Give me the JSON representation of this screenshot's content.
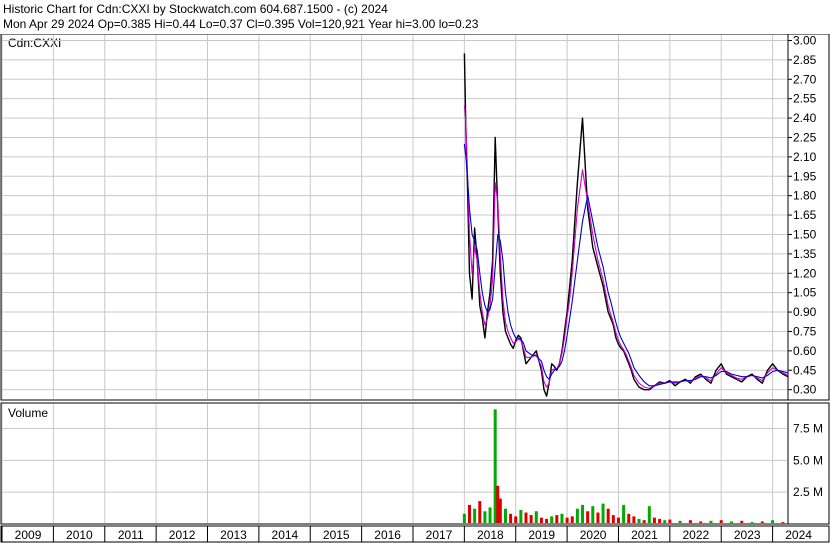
{
  "header": {
    "line1": "Historic Chart for Cdn:CXXI by Stockwatch.com 604.687.1500 - (c) 2024",
    "line2": "Mon Apr 29 2024   Op=0.385  Hi=0.44  Lo=0.37  Cl=0.395  Vol=120,921  Year hi=3.00  lo=0.23"
  },
  "chart_data": [
    {
      "type": "line",
      "panel_label": "Cdn:CXXI",
      "ylim": [
        0.22,
        3.05
      ],
      "y_ticks": [
        "3.00",
        "2.85",
        "2.70",
        "2.55",
        "2.40",
        "2.25",
        "2.10",
        "1.95",
        "1.80",
        "1.65",
        "1.50",
        "1.35",
        "1.20",
        "1.05",
        "0.90",
        "0.75",
        "0.60",
        "0.45",
        "0.30"
      ],
      "x_ticks": [
        "2009",
        "2010",
        "2011",
        "2012",
        "2013",
        "2014",
        "2015",
        "2016",
        "2017",
        "2018",
        "2019",
        "2020",
        "2021",
        "2022",
        "2023",
        "2024"
      ],
      "grid": true,
      "colors": {
        "price": "#000000",
        "ma_short": "#cc00cc",
        "ma_long": "#0000cc",
        "grid": "#c8c8c8"
      },
      "x": [
        2018.0,
        2018.03,
        2018.06,
        2018.1,
        2018.15,
        2018.2,
        2018.25,
        2018.3,
        2018.35,
        2018.4,
        2018.45,
        2018.5,
        2018.55,
        2018.6,
        2018.65,
        2018.7,
        2018.75,
        2018.8,
        2018.85,
        2018.9,
        2018.95,
        2019.0,
        2019.05,
        2019.1,
        2019.15,
        2019.2,
        2019.3,
        2019.4,
        2019.5,
        2019.55,
        2019.6,
        2019.65,
        2019.7,
        2019.75,
        2019.8,
        2019.85,
        2019.9,
        2019.95,
        2020.0,
        2020.05,
        2020.1,
        2020.2,
        2020.3,
        2020.4,
        2020.5,
        2020.6,
        2020.7,
        2020.75,
        2020.8,
        2020.85,
        2020.9,
        2020.95,
        2021.0,
        2021.05,
        2021.1,
        2021.15,
        2021.2,
        2021.25,
        2021.3,
        2021.4,
        2021.5,
        2021.6,
        2021.7,
        2021.8,
        2021.9,
        2022.0,
        2022.1,
        2022.2,
        2022.3,
        2022.4,
        2022.5,
        2022.6,
        2022.7,
        2022.8,
        2022.9,
        2023.0,
        2023.1,
        2023.2,
        2023.3,
        2023.4,
        2023.5,
        2023.6,
        2023.7,
        2023.8,
        2023.9,
        2024.0,
        2024.1,
        2024.2,
        2024.3
      ],
      "series": [
        {
          "key": "price",
          "values": [
            2.9,
            2.3,
            1.9,
            1.2,
            1.0,
            1.55,
            1.3,
            0.95,
            0.85,
            0.7,
            0.9,
            1.05,
            1.3,
            2.25,
            1.7,
            1.2,
            0.9,
            0.75,
            0.7,
            0.65,
            0.62,
            0.68,
            0.72,
            0.7,
            0.6,
            0.5,
            0.55,
            0.6,
            0.45,
            0.3,
            0.25,
            0.35,
            0.5,
            0.48,
            0.45,
            0.5,
            0.6,
            0.75,
            0.9,
            1.1,
            1.3,
            1.9,
            2.4,
            1.7,
            1.4,
            1.25,
            1.1,
            1.0,
            0.9,
            0.85,
            0.8,
            0.7,
            0.65,
            0.62,
            0.6,
            0.55,
            0.5,
            0.45,
            0.38,
            0.32,
            0.3,
            0.3,
            0.33,
            0.36,
            0.35,
            0.37,
            0.33,
            0.36,
            0.38,
            0.35,
            0.4,
            0.42,
            0.38,
            0.35,
            0.45,
            0.5,
            0.42,
            0.4,
            0.38,
            0.36,
            0.4,
            0.42,
            0.38,
            0.35,
            0.45,
            0.5,
            0.45,
            0.42,
            0.4
          ]
        },
        {
          "key": "ma_short",
          "values": [
            2.5,
            2.35,
            2.0,
            1.5,
            1.2,
            1.4,
            1.3,
            1.05,
            0.9,
            0.8,
            0.85,
            0.95,
            1.15,
            1.9,
            1.75,
            1.35,
            1.0,
            0.82,
            0.75,
            0.7,
            0.66,
            0.67,
            0.69,
            0.68,
            0.62,
            0.55,
            0.55,
            0.57,
            0.48,
            0.36,
            0.32,
            0.35,
            0.45,
            0.46,
            0.46,
            0.5,
            0.58,
            0.7,
            0.86,
            1.0,
            1.2,
            1.7,
            2.0,
            1.75,
            1.5,
            1.3,
            1.15,
            1.05,
            0.95,
            0.88,
            0.82,
            0.74,
            0.68,
            0.64,
            0.61,
            0.57,
            0.52,
            0.47,
            0.41,
            0.35,
            0.32,
            0.31,
            0.33,
            0.35,
            0.35,
            0.36,
            0.35,
            0.36,
            0.37,
            0.36,
            0.39,
            0.41,
            0.39,
            0.37,
            0.42,
            0.47,
            0.43,
            0.41,
            0.39,
            0.38,
            0.4,
            0.41,
            0.39,
            0.37,
            0.43,
            0.47,
            0.45,
            0.43,
            0.41
          ]
        },
        {
          "key": "ma_long",
          "values": [
            2.2,
            2.1,
            1.95,
            1.7,
            1.5,
            1.45,
            1.38,
            1.2,
            1.05,
            0.95,
            0.9,
            0.92,
            1.0,
            1.25,
            1.5,
            1.45,
            1.3,
            1.05,
            0.9,
            0.8,
            0.74,
            0.7,
            0.7,
            0.69,
            0.66,
            0.6,
            0.57,
            0.56,
            0.52,
            0.45,
            0.4,
            0.38,
            0.42,
            0.45,
            0.46,
            0.48,
            0.52,
            0.6,
            0.72,
            0.85,
            0.98,
            1.3,
            1.6,
            1.8,
            1.6,
            1.4,
            1.25,
            1.15,
            1.05,
            0.98,
            0.9,
            0.82,
            0.75,
            0.7,
            0.66,
            0.62,
            0.58,
            0.53,
            0.47,
            0.41,
            0.36,
            0.33,
            0.33,
            0.34,
            0.35,
            0.36,
            0.36,
            0.36,
            0.37,
            0.37,
            0.38,
            0.4,
            0.4,
            0.39,
            0.41,
            0.44,
            0.44,
            0.42,
            0.41,
            0.4,
            0.4,
            0.41,
            0.4,
            0.39,
            0.41,
            0.44,
            0.45,
            0.44,
            0.43
          ]
        }
      ]
    },
    {
      "type": "bar",
      "panel_label": "Volume",
      "ylim": [
        0,
        9500000
      ],
      "y_ticks": [
        "7.5 M",
        "5.0 M",
        "2.5 M"
      ],
      "y_tick_values": [
        7500000,
        5000000,
        2500000
      ],
      "colors": {
        "up": "#00aa00",
        "down": "#dd0000"
      },
      "x": [
        2018.0,
        2018.1,
        2018.2,
        2018.3,
        2018.4,
        2018.5,
        2018.6,
        2018.65,
        2018.7,
        2018.8,
        2018.9,
        2019.0,
        2019.1,
        2019.2,
        2019.3,
        2019.4,
        2019.5,
        2019.6,
        2019.7,
        2019.8,
        2019.9,
        2020.0,
        2020.1,
        2020.2,
        2020.3,
        2020.4,
        2020.5,
        2020.6,
        2020.7,
        2020.8,
        2020.9,
        2021.0,
        2021.1,
        2021.2,
        2021.3,
        2021.4,
        2021.5,
        2021.6,
        2021.7,
        2021.8,
        2021.9,
        2022.0,
        2022.2,
        2022.4,
        2022.6,
        2022.8,
        2023.0,
        2023.2,
        2023.4,
        2023.6,
        2023.8,
        2024.0,
        2024.2
      ],
      "values": [
        800000,
        1500000,
        1200000,
        1800000,
        1000000,
        1300000,
        9000000,
        3000000,
        2000000,
        1200000,
        800000,
        600000,
        1100000,
        900000,
        700000,
        1000000,
        500000,
        400000,
        600000,
        700000,
        800000,
        500000,
        600000,
        1200000,
        1500000,
        1000000,
        1400000,
        900000,
        1600000,
        1200000,
        700000,
        500000,
        1500000,
        800000,
        600000,
        400000,
        300000,
        1400000,
        500000,
        400000,
        300000,
        350000,
        250000,
        300000,
        200000,
        250000,
        300000,
        200000,
        250000,
        150000,
        200000,
        300000,
        150000
      ],
      "up": [
        true,
        false,
        true,
        false,
        true,
        true,
        true,
        false,
        false,
        true,
        false,
        false,
        true,
        false,
        false,
        true,
        false,
        false,
        true,
        false,
        true,
        false,
        false,
        true,
        true,
        false,
        true,
        false,
        true,
        false,
        false,
        false,
        true,
        false,
        false,
        true,
        false,
        true,
        false,
        false,
        true,
        false,
        true,
        false,
        false,
        true,
        false,
        true,
        false,
        true,
        false,
        true,
        false
      ]
    }
  ]
}
